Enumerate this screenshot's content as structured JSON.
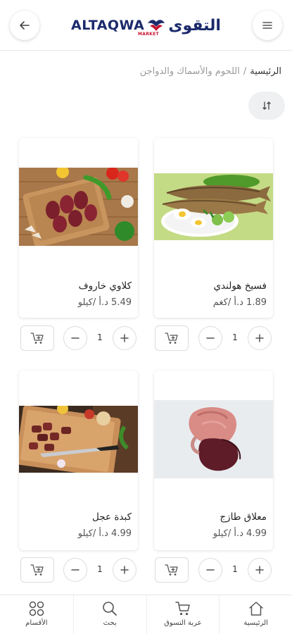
{
  "header": {
    "logo_latin": "ALTAQWA",
    "logo_arabic": "التقوى",
    "logo_tag": "MARKET",
    "menu_icon": "hamburger-icon",
    "back_icon": "arrow-left-icon"
  },
  "breadcrumb": {
    "home": "الرئيسية",
    "separator": "/",
    "current": "اللحوم والأسماك والدواجن"
  },
  "sort": {
    "icon": "sort-arrows-icon"
  },
  "products": [
    {
      "name": "فسيخ هولندي",
      "price": "1.89 د.أ /كغم",
      "qty": "1"
    },
    {
      "name": "كلاوي خاروف",
      "price": "5.49 د.أ /كيلو",
      "qty": "1"
    },
    {
      "name": "معلاق طازج",
      "price": "4.99 د.أ /كيلو",
      "qty": "1"
    },
    {
      "name": "كبدة عجل",
      "price": "4.99 د.أ /كيلو",
      "qty": "1"
    }
  ],
  "bottom_nav": [
    {
      "label": "الأقسام",
      "icon": "grid-icon"
    },
    {
      "label": "بحث",
      "icon": "search-icon"
    },
    {
      "label": "عربة التسوق",
      "icon": "cart-icon"
    },
    {
      "label": "الرئيسية",
      "icon": "home-icon"
    }
  ],
  "colors": {
    "brand_navy": "#1b2a6b",
    "brand_red": "#c8102e",
    "icon_gray": "#555555"
  }
}
